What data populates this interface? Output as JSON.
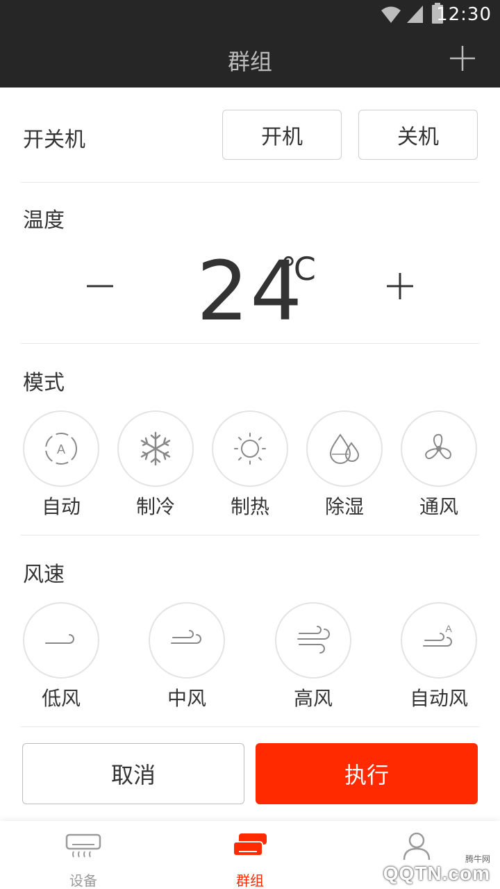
{
  "status_bar": {
    "time": "12:30",
    "icons": [
      "wifi-icon",
      "signal-icon",
      "battery-icon"
    ]
  },
  "app_bar": {
    "title": "群组",
    "action_icon": "add-icon"
  },
  "power": {
    "label": "开关机",
    "on_label": "开机",
    "off_label": "关机"
  },
  "temperature": {
    "label": "温度",
    "value": "24",
    "unit": "℃",
    "decrease_icon": "minus-icon",
    "increase_icon": "plus-icon"
  },
  "mode": {
    "label": "模式",
    "options": [
      {
        "label": "自动",
        "icon": "auto-mode-icon"
      },
      {
        "label": "制冷",
        "icon": "snowflake-icon"
      },
      {
        "label": "制热",
        "icon": "sun-icon"
      },
      {
        "label": "除湿",
        "icon": "water-drops-icon"
      },
      {
        "label": "通风",
        "icon": "fan-icon"
      }
    ]
  },
  "fan_speed": {
    "label": "风速",
    "options": [
      {
        "label": "低风",
        "icon": "wind-low-icon"
      },
      {
        "label": "中风",
        "icon": "wind-medium-icon"
      },
      {
        "label": "高风",
        "icon": "wind-high-icon"
      },
      {
        "label": "自动风",
        "icon": "wind-auto-icon"
      }
    ]
  },
  "actions": {
    "cancel_label": "取消",
    "execute_label": "执行"
  },
  "tabs": [
    {
      "label": "设备",
      "icon": "air-conditioner-icon",
      "active": false
    },
    {
      "label": "群组",
      "icon": "group-icon",
      "active": true
    },
    {
      "label": "",
      "icon": "user-icon",
      "active": false
    }
  ],
  "watermark": {
    "small": "腾牛网",
    "big": "QQTN.com"
  },
  "colors": {
    "accent": "#ff2a00",
    "header_bg": "#262626",
    "inactive": "#9a9a9a"
  }
}
